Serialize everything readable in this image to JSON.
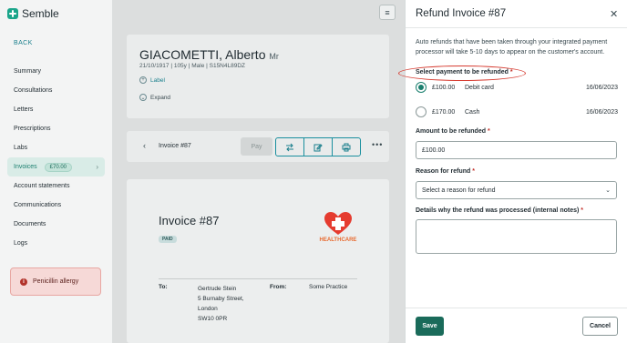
{
  "app": {
    "name": "Semble"
  },
  "sidebar": {
    "back_label": "BACK",
    "items": [
      {
        "label": "Summary"
      },
      {
        "label": "Consultations"
      },
      {
        "label": "Letters"
      },
      {
        "label": "Prescriptions"
      },
      {
        "label": "Labs"
      },
      {
        "label": "Invoices",
        "badge": "£70.00",
        "active": true
      },
      {
        "label": "Account statements"
      },
      {
        "label": "Communications"
      },
      {
        "label": "Documents"
      },
      {
        "label": "Logs"
      }
    ],
    "allergy": "Penicillin allergy"
  },
  "patient": {
    "name": "GIACOMETTI, Alberto",
    "title": "Mr",
    "meta": "21/10/1917  |  105y  |  Male  |  S15N4L89DZ",
    "label_action": "Label",
    "expand_action": "Expand"
  },
  "toolbar": {
    "invoice_label": "Invoice #87",
    "pay_label": "Pay"
  },
  "invoice": {
    "title": "Invoice #87",
    "status": "PAID",
    "brand": {
      "part1": "HEALTH",
      "part2": "CARE"
    },
    "to_label": "To:",
    "to_lines": [
      "Gertrude Stein",
      "5 Burnaby Street,",
      "London",
      "SW10 0PR"
    ],
    "from_label": "From:",
    "from_value": "Some Practice"
  },
  "drawer": {
    "title": "Refund Invoice #87",
    "description": "Auto refunds that have been taken through your integrated payment processor will take 5-10 days to appear on the customer's account.",
    "select_payment_label": "Select payment to be refunded",
    "payments": [
      {
        "amount": "£100.00",
        "method": "Debit card",
        "date": "16/06/2023",
        "selected": true
      },
      {
        "amount": "£170.00",
        "method": "Cash",
        "date": "16/06/2023",
        "selected": false
      }
    ],
    "amount_label": "Amount to be refunded",
    "amount_value": "£100.00",
    "reason_label": "Reason for refund",
    "reason_placeholder": "Select a reason for refund",
    "details_label": "Details why the refund was processed (internal notes)",
    "required_mark": "*",
    "save_label": "Save",
    "cancel_label": "Cancel"
  },
  "colors": {
    "brand_green": "#1aa58a",
    "primary_button": "#1a6b5a",
    "accent_teal": "#1a7f8c",
    "highlight_red": "#d63b30"
  }
}
